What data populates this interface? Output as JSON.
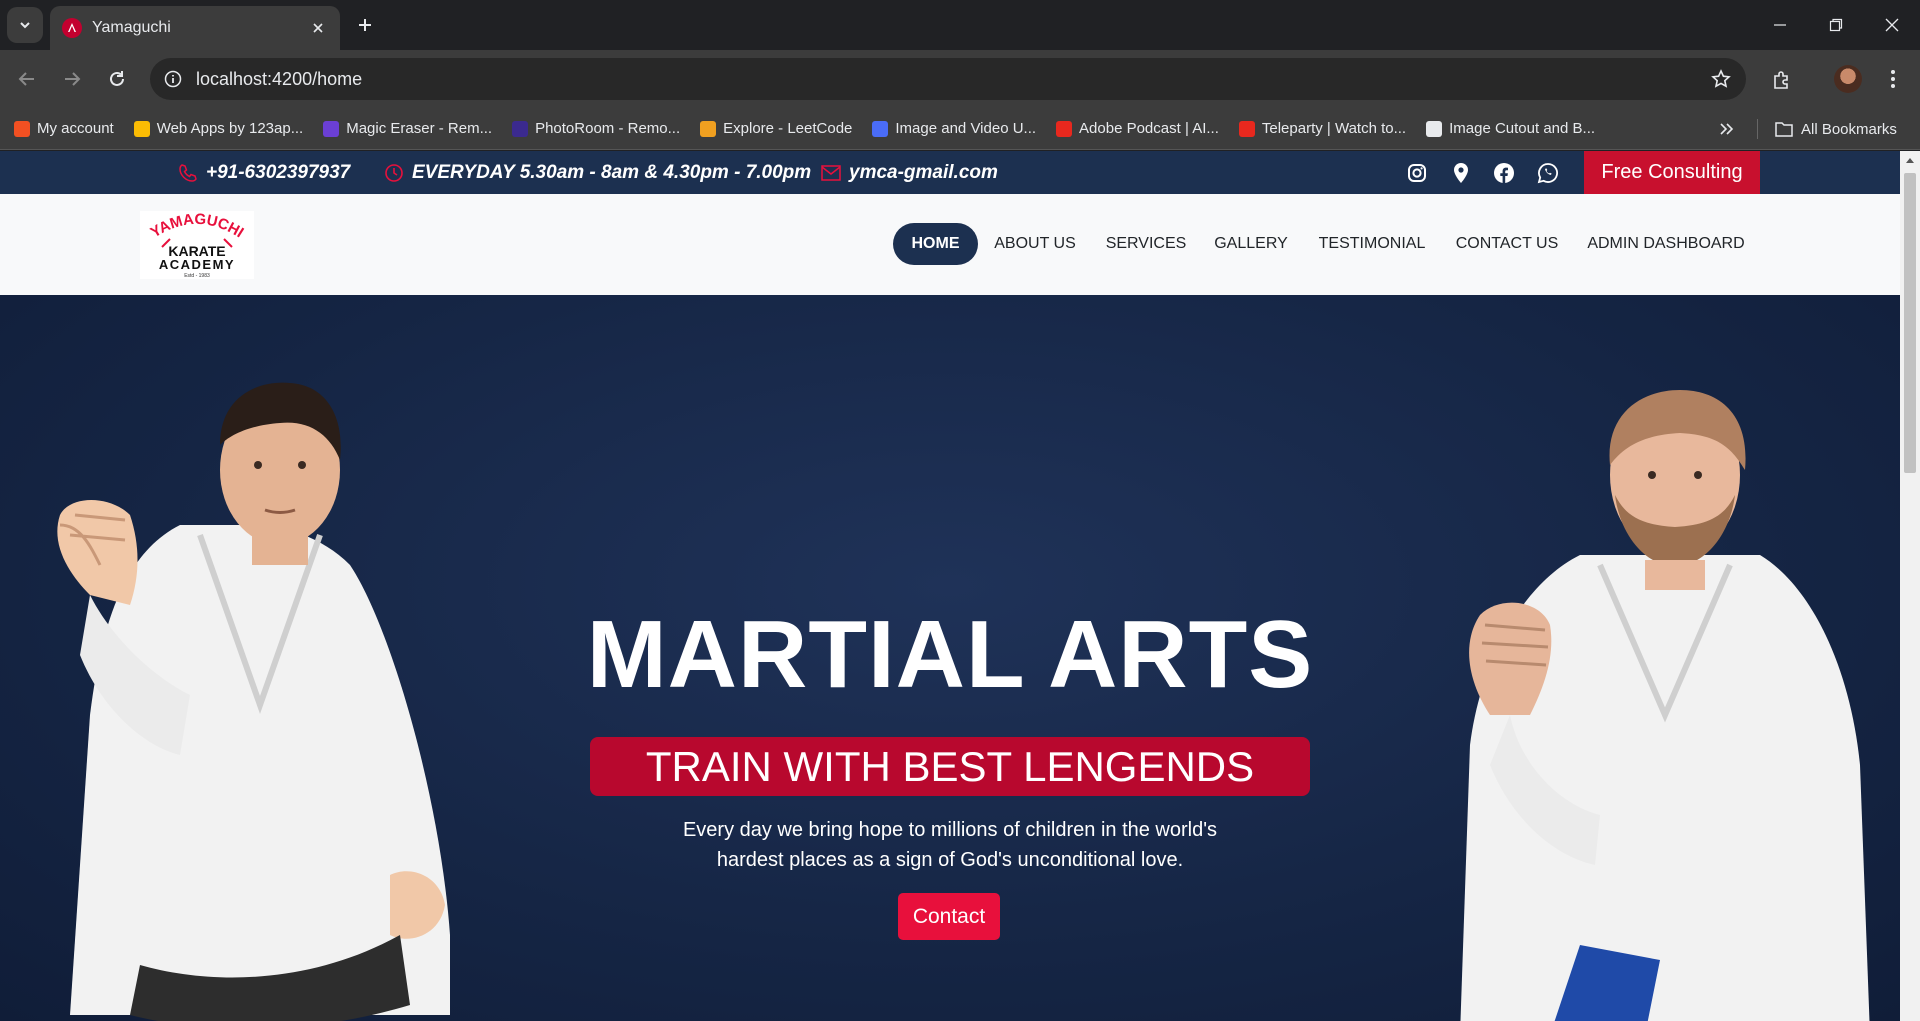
{
  "browser": {
    "tab_title": "Yamaguchi",
    "url": "localhost:4200/home",
    "bookmarks": [
      {
        "label": "My account",
        "icon": "microsoft-icon",
        "color": "#f25022"
      },
      {
        "label": "Web Apps by 123ap...",
        "icon": "apps-icon",
        "color": "#fbbc04"
      },
      {
        "label": "Magic Eraser - Rem...",
        "icon": "magic-eraser-icon",
        "color": "#6b3fd4"
      },
      {
        "label": "PhotoRoom - Remo...",
        "icon": "photoroom-icon",
        "color": "#3b2a8f"
      },
      {
        "label": "Explore - LeetCode",
        "icon": "leetcode-icon",
        "color": "#f0a020"
      },
      {
        "label": "Image and Video U...",
        "icon": "image-video-icon",
        "color": "#4a6cf7"
      },
      {
        "label": "Adobe Podcast | AI...",
        "icon": "adobe-icon",
        "color": "#e8281e"
      },
      {
        "label": "Teleparty | Watch to...",
        "icon": "teleparty-icon",
        "color": "#e8281e"
      },
      {
        "label": "Image Cutout and B...",
        "icon": "cutout-icon",
        "color": "#e8eaed"
      }
    ],
    "all_bookmarks": "All Bookmarks"
  },
  "topbar": {
    "phone": "+91-6302397937",
    "hours": "EVERYDAY 5.30am - 8am & 4.30pm - 7.00pm",
    "email": "ymca-gmail.com",
    "consult_button": "Free Consulting"
  },
  "logo": {
    "line1": "YAMAGUCHI",
    "line2": "KARATE",
    "line3": "ACADEMY",
    "line4": "Estd - 1983"
  },
  "nav": [
    {
      "label": "HOME",
      "active": true
    },
    {
      "label": "ABOUT US"
    },
    {
      "label": "SERVICES"
    },
    {
      "label": "GALLERY"
    },
    {
      "label": "TESTIMONIAL"
    },
    {
      "label": "CONTACT US"
    },
    {
      "label": "ADMIN DASHBOARD"
    }
  ],
  "hero": {
    "title": "MARTIAL ARTS",
    "banner": "TRAIN WITH BEST LENGENDS",
    "text": "Every day we bring hope to millions of children in the world's hardest places as a sign of God's unconditional love.",
    "button": "Contact"
  },
  "colors": {
    "navy": "#1c3050",
    "accent_red": "#c8102e"
  }
}
